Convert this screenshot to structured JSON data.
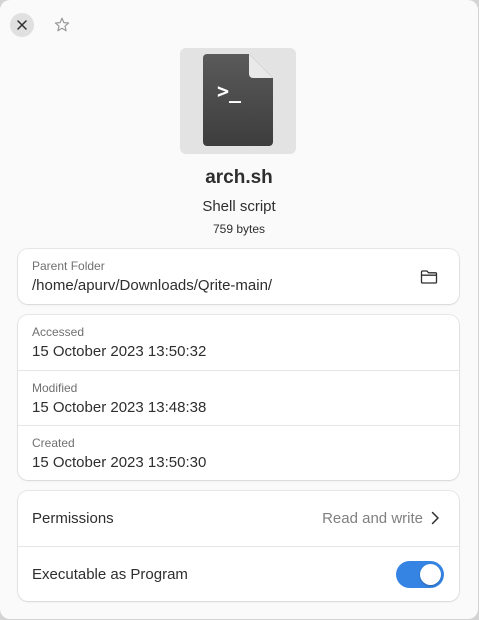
{
  "header": {
    "close_icon": "close-icon",
    "star_icon": "star-icon"
  },
  "file": {
    "icon": "shell-script-file-icon",
    "icon_glyph": ">_",
    "name": "arch.sh",
    "type": "Shell script",
    "size": "759 bytes"
  },
  "location": {
    "label": "Parent Folder",
    "path": "/home/apurv/Downloads/Qrite-main/",
    "open_icon": "folder-icon"
  },
  "times": [
    {
      "label": "Accessed",
      "value": "15 October 2023 13:50:32"
    },
    {
      "label": "Modified",
      "value": "15 October 2023 13:48:38"
    },
    {
      "label": "Created",
      "value": "15 October 2023 13:50:30"
    }
  ],
  "permissions": {
    "label": "Permissions",
    "value": "Read and write",
    "chevron_icon": "chevron-right-icon"
  },
  "executable": {
    "label": "Executable as Program",
    "enabled": true
  },
  "colors": {
    "accent": "#3584e4",
    "window_bg": "#fafafa",
    "card_bg": "#ffffff"
  }
}
